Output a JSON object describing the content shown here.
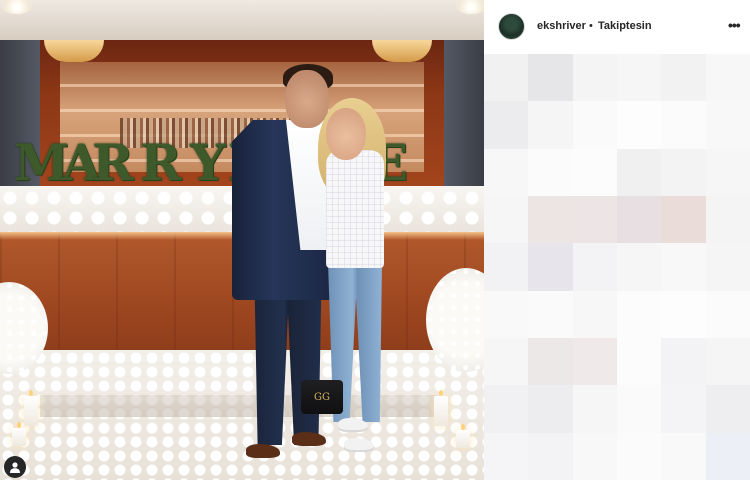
{
  "post": {
    "username": "ekshriver",
    "separator": "•",
    "follow_state": "Takiptesin",
    "more_icon": "more-options-icon",
    "avatar_icon": "profile-avatar"
  },
  "photo": {
    "sign_text": "MARRY ME",
    "tag_icon": "user-tag-icon",
    "handbag_logo": "GG"
  },
  "colors": {
    "brand_text": "#262626",
    "panel_bg": "#ffffff",
    "divider": "#dbdbdb"
  },
  "pixelated_comments": {
    "tiles": [
      "#f1f1f1",
      "#e6e6e8",
      "#f4f4f4",
      "#f6f6f6",
      "#f2f2f3",
      "#f7f7f7",
      "#ececee",
      "#f5f5f5",
      "#fafafa",
      "#fdfdfd",
      "#fbfbfb",
      "#f8f8f8",
      "#f7f7f8",
      "#fbfbfb",
      "#fcfcfc",
      "#f0f0f0",
      "#f3f3f4",
      "#f6f6f7",
      "#f6f6f6",
      "#ece5e3",
      "#ede4e6",
      "#e8dfe3",
      "#e9dcd9",
      "#f4f4f4",
      "#f2f2f4",
      "#e7e4eb",
      "#f3f3f5",
      "#f6f6f6",
      "#f8f8f8",
      "#f5f5f5",
      "#f9f9f9",
      "#fafafa",
      "#f7f7f7",
      "#fcfcfc",
      "#fdfdfd",
      "#fbfbfb",
      "#f6f6f7",
      "#ece8e8",
      "#efe9ea",
      "#fcfcfc",
      "#f3f3f5",
      "#f5f5f6",
      "#f1f1f3",
      "#ededf0",
      "#f6f6f6",
      "#fafafa",
      "#f4f4f6",
      "#eeeef1",
      "#f5f5f7",
      "#f3f3f5",
      "#f8f8f8",
      "#fbfbfb",
      "#f9f9fa",
      "#ecf0f6"
    ]
  }
}
